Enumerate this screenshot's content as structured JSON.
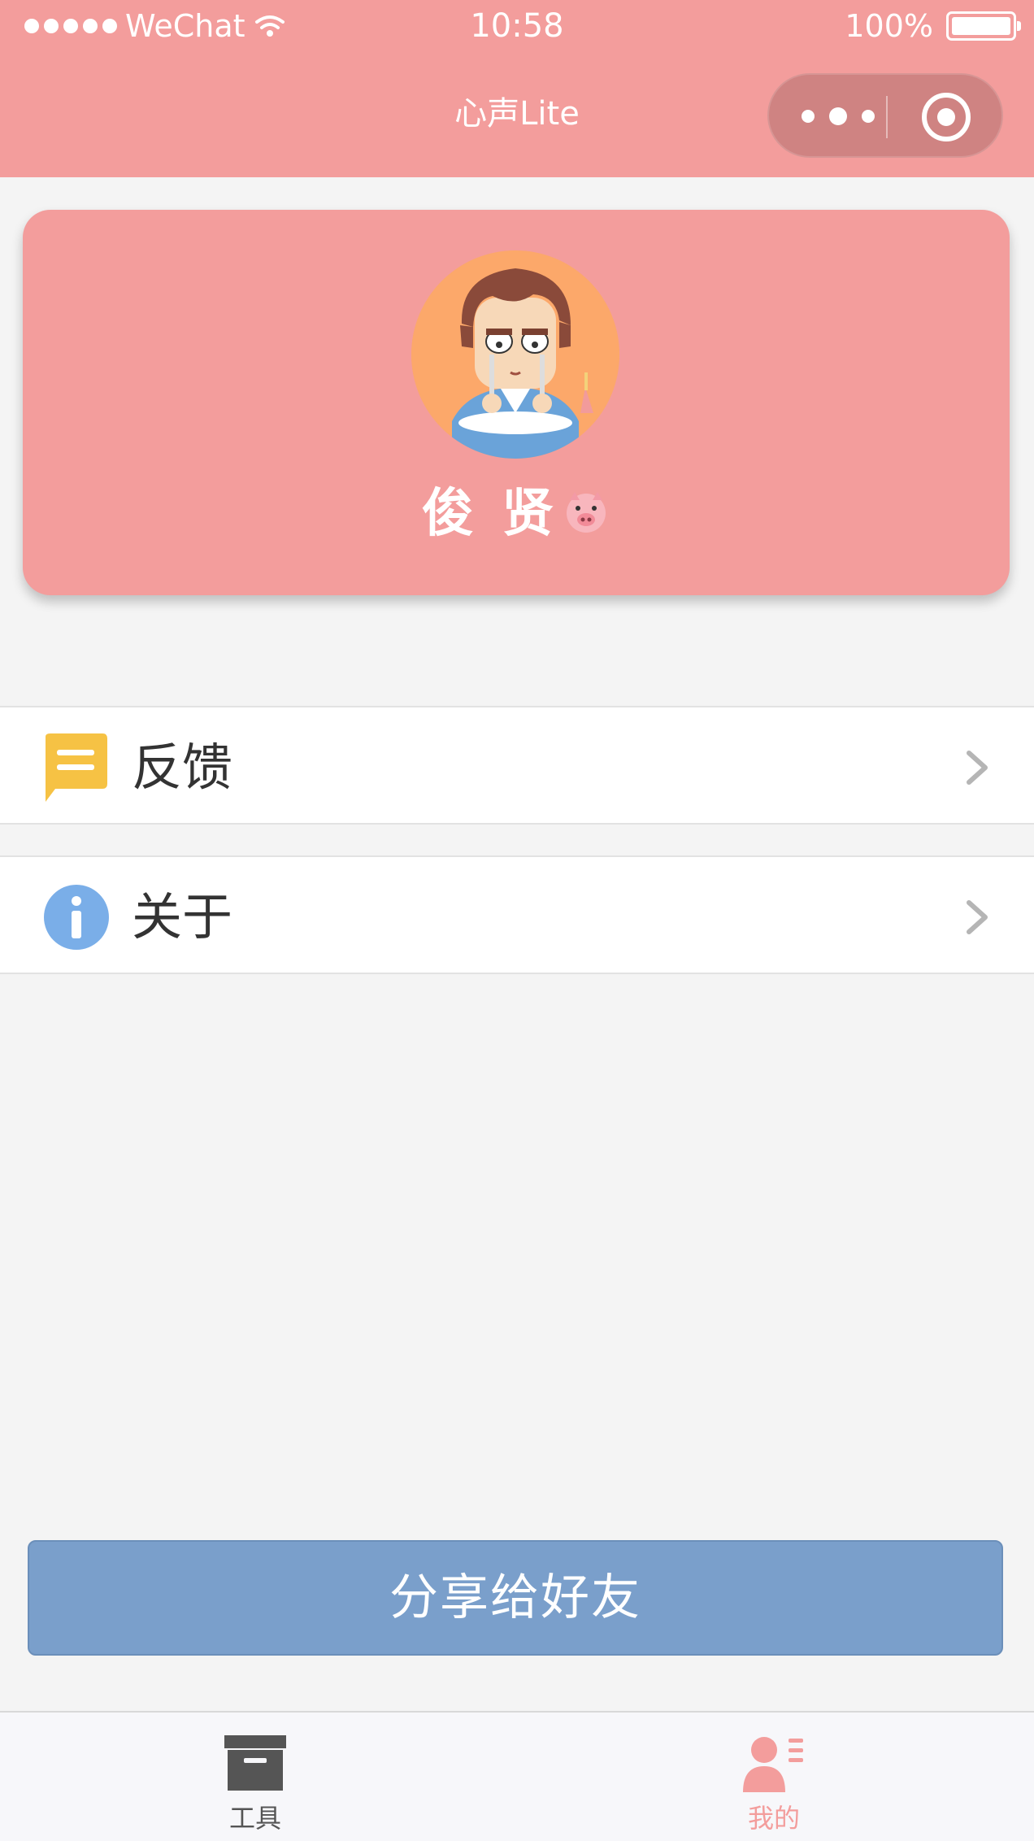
{
  "status_bar": {
    "carrier": "WeChat",
    "time": "10:58",
    "battery": "100%"
  },
  "nav": {
    "title": "心声Lite"
  },
  "profile": {
    "name": "俊 贤"
  },
  "menu": [
    {
      "label": "反馈",
      "icon": "feedback-icon",
      "icon_color": "#f6c244"
    },
    {
      "label": "关于",
      "icon": "info-icon",
      "icon_color": "#7aaee8"
    }
  ],
  "share_button": {
    "label": "分享给好友"
  },
  "tabbar": {
    "tabs": [
      {
        "label": "工具",
        "icon": "archive-box-icon",
        "active": false
      },
      {
        "label": "我的",
        "icon": "user-profile-icon",
        "active": true
      }
    ]
  },
  "colors": {
    "header": "#f39d9c",
    "share_button": "#7a9fcb",
    "active_tab": "#f39d9c"
  }
}
